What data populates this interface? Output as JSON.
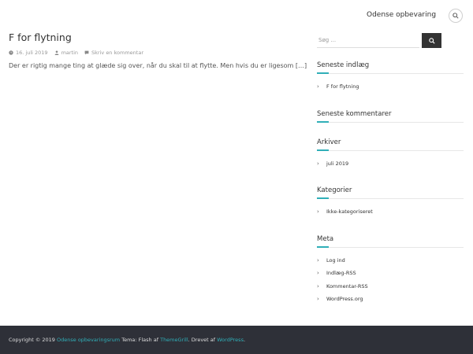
{
  "header": {
    "site_title": "Odense opbevaring",
    "search_icon": "search-icon"
  },
  "post": {
    "title": "F for flytning",
    "date": "16. juli 2019",
    "author": "martin",
    "comment_link": "Skriv en kommentar",
    "excerpt": "Der er rigtig mange ting at glæde sig over, når du skal til at flytte. Men hvis du er ligesom […]"
  },
  "sidebar": {
    "search_placeholder": "Søg ...",
    "recent_posts": {
      "title": "Seneste indlæg",
      "items": [
        "F for flytning"
      ]
    },
    "recent_comments": {
      "title": "Seneste kommentarer"
    },
    "archives": {
      "title": "Arkiver",
      "items": [
        "juli 2019"
      ]
    },
    "categories": {
      "title": "Kategorier",
      "items": [
        "Ikke-kategoriseret"
      ]
    },
    "meta": {
      "title": "Meta",
      "items": [
        "Log ind",
        "Indlæg-RSS",
        "Kommentar-RSS",
        "WordPress.org"
      ]
    }
  },
  "footer": {
    "copyright_prefix": "Copyright © 2019",
    "site_link": "Odense opbevaringsrum",
    "theme_text": "Tema: Flash af",
    "theme_link": "ThemeGrill",
    "powered_text": "Drevet af",
    "powered_link": "WordPress"
  },
  "colors": {
    "accent": "#30afb8",
    "footer_bg": "#2e3038",
    "button_bg": "#333333"
  }
}
